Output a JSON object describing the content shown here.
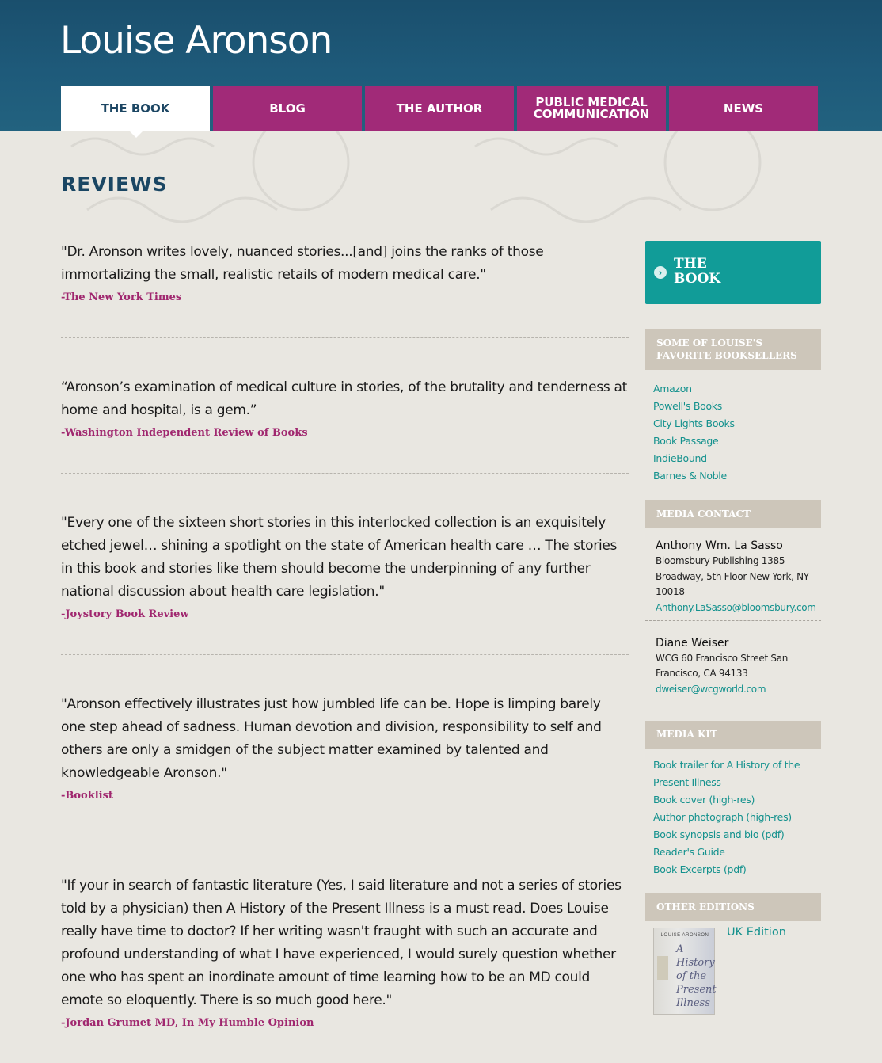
{
  "header": {
    "site_title": "Louise Aronson"
  },
  "nav": [
    {
      "label": "THE BOOK",
      "active": true
    },
    {
      "label": "BLOG"
    },
    {
      "label": "THE AUTHOR"
    },
    {
      "label": "PUBLIC MEDICAL COMMUNICATION"
    },
    {
      "label": "NEWS"
    }
  ],
  "main": {
    "section_title": "REVIEWS",
    "reviews": [
      {
        "quote": "\"Dr. Aronson writes lovely, nuanced stories...[and] joins the ranks of those immortalizing the small, realistic retails of modern medical care.\"",
        "source": "-The New York Times"
      },
      {
        "quote": "“Aronson’s examination of medical culture in stories, of the brutality and tenderness at home and hospital, is a gem.”",
        "source": "-Washington Independent Review of Books"
      },
      {
        "quote": "\"Every one of the sixteen short stories in this interlocked collection is an exquisitely etched jewel… shining a spotlight on the state of American health care … The stories in this book and stories like them should become the underpinning of any further national discussion about health care legislation.\"",
        "source": "-Joystory Book Review"
      },
      {
        "quote": "\"Aronson effectively illustrates just how jumbled life can be. Hope is limping barely one step ahead of sadness. Human devotion and division, responsibility to self and others are only a smidgen of the subject matter examined by talented and knowledgeable Aronson.\"",
        "source": "-Booklist"
      },
      {
        "quote": "\"If your in search of fantastic literature (Yes, I said literature and not a series of stories told by a physician) then A History of the Present Illness is a must read. Does Louise really have time to doctor? If her writing wasn't fraught with such an accurate and profound understanding of what I have experienced, I would surely question whether one who has spent an inordinate amount of time learning how to be an MD could emote so eloquently. There is so much good here.\"",
        "source": "-Jordan Grumet MD, In My Humble Opinion"
      }
    ]
  },
  "sidebar": {
    "book_button": "THE BOOK",
    "booksellers_title": "SOME OF LOUISE'S FAVORITE BOOKSELLERS",
    "booksellers": [
      "Amazon",
      "Powell's Books",
      "City Lights Books",
      "Book Passage",
      "IndieBound",
      "Barnes & Noble"
    ],
    "media_contact_title": "MEDIA CONTACT",
    "contacts": [
      {
        "name": "Anthony Wm. La Sasso",
        "address": "Bloomsbury Publishing 1385 Broadway, 5th Floor New York, NY 10018",
        "email": "Anthony.LaSasso@bloomsbury.com"
      },
      {
        "name": "Diane Weiser",
        "address": "WCG 60 Francisco Street San Francisco, CA 94133",
        "email": "dweiser@wcgworld.com"
      }
    ],
    "media_kit_title": "MEDIA KIT",
    "media_kit": [
      "Book trailer for A History of the Present Illness",
      "Book cover (high-res)",
      "Author photograph (high-res)",
      "Book synopsis and bio (pdf)",
      "Reader's Guide",
      "Book Excerpts (pdf)"
    ],
    "other_editions_title": "OTHER EDITIONS",
    "edition": {
      "label": "UK Edition",
      "cover_author": "LOUISE ARONSON",
      "cover_title": "A History of the Present Illness"
    }
  },
  "colors": {
    "header": "#1e5a7a",
    "nav": "#a12a78",
    "accent": "#119c98",
    "source": "#a0276f",
    "sidebar_head": "#cdc6ba"
  }
}
